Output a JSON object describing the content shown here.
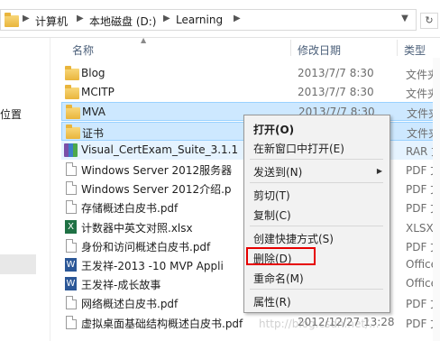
{
  "address_bar": {
    "crumbs": [
      "计算机",
      "本地磁盘 (D:)",
      "Learning"
    ],
    "separator": "▶"
  },
  "nav_pane": {
    "items": [
      "位置"
    ]
  },
  "columns": {
    "name": "名称",
    "date": "修改日期",
    "type": "类型"
  },
  "files": [
    {
      "name": "Blog",
      "date": "2013/7/7 8:30",
      "type": "文件夹",
      "icon": "folder-icon",
      "state": "normal"
    },
    {
      "name": "MCITP",
      "date": "2013/7/7 8:30",
      "type": "文件夹",
      "icon": "folder-icon",
      "state": "normal"
    },
    {
      "name": "MVA",
      "date": "2013/7/7 8:30",
      "type": "文件夹",
      "icon": "folder-icon",
      "state": "selected"
    },
    {
      "name": "证书",
      "date": "2013/7/7 8:30",
      "type": "文件夹",
      "icon": "folder-icon",
      "state": "selected"
    },
    {
      "name": "Visual_CertExam_Suite_3.1.1",
      "date": "",
      "type": "RAR 文",
      "icon": "rar-icon",
      "state": "selected-light"
    },
    {
      "name": "Windows Server 2012服务器",
      "date": "",
      "type": "PDF 文",
      "icon": "document-icon",
      "state": "normal"
    },
    {
      "name": "Windows Server 2012介绍.p",
      "date": "",
      "type": "PDF 文",
      "icon": "document-icon",
      "state": "normal"
    },
    {
      "name": "存储概述白皮书.pdf",
      "date": "",
      "type": "PDF 文",
      "icon": "document-icon",
      "state": "normal"
    },
    {
      "name": "计数器中英文对照.xlsx",
      "date": "",
      "type": "XLSX 文",
      "icon": "excel-icon",
      "state": "normal"
    },
    {
      "name": "身份和访问概述白皮书.pdf",
      "date": "",
      "type": "PDF 文",
      "icon": "document-icon",
      "state": "normal"
    },
    {
      "name": "王发祥-2013 -10 MVP Appli",
      "date": "",
      "type": "Office",
      "icon": "word-icon",
      "state": "normal"
    },
    {
      "name": "王发祥-成长故事",
      "date": "",
      "type": "Office",
      "icon": "word-icon",
      "state": "normal"
    },
    {
      "name": "网络概述白皮书.pdf",
      "date": "",
      "type": "PDF 文",
      "icon": "document-icon",
      "state": "normal"
    },
    {
      "name": "虚拟桌面基础结构概述白皮书.pdf",
      "date": "2012/12/27 13:28",
      "type": "PDF 文",
      "icon": "document-icon",
      "state": "normal"
    }
  ],
  "context_menu": {
    "open": "打开(O)",
    "open_new_window": "在新窗口中打开(E)",
    "send_to": "发送到(N)",
    "cut": "剪切(T)",
    "copy": "复制(C)",
    "create_shortcut": "创建快捷方式(S)",
    "delete": "删除(D)",
    "rename": "重命名(M)",
    "properties": "属性(R)"
  },
  "watermark": "http://blog.csdn.net/..."
}
